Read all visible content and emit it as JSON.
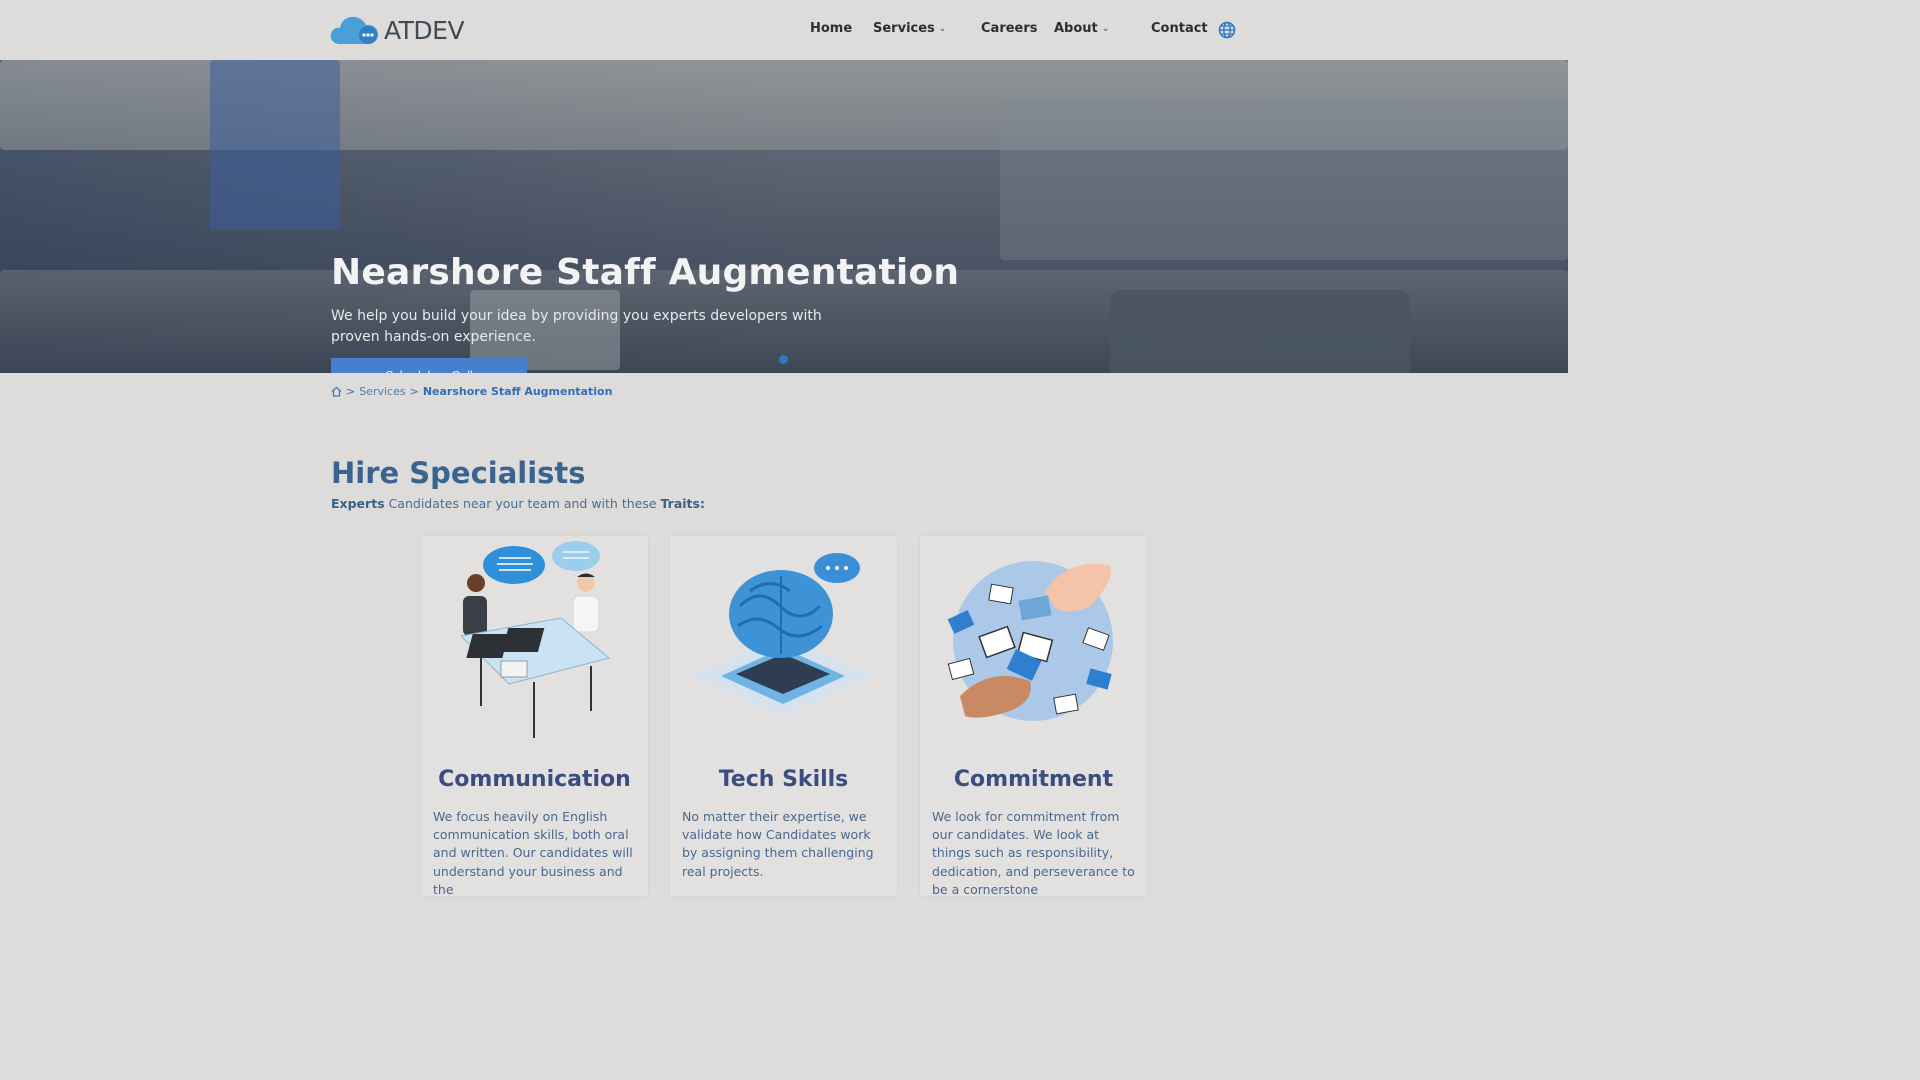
{
  "header": {
    "logo_text": "ATDEV",
    "nav": [
      {
        "label": "Home"
      },
      {
        "label": "Services",
        "dropdown": true
      },
      {
        "label": "Careers"
      },
      {
        "label": "About",
        "dropdown": true
      },
      {
        "label": "Contact"
      }
    ],
    "globe_icon": "globe-icon"
  },
  "hero": {
    "title": "Nearshore Staff Augmentation",
    "subtitle": "We help you build your idea by providing you experts developers with proven hands-on experience.",
    "cta_label": "Schedule a Call"
  },
  "breadcrumb": {
    "home_icon": "home-icon",
    "sep": ">",
    "items": [
      "Services",
      "Nearshore Staff Augmentation"
    ]
  },
  "section": {
    "title": "Hire Specialists",
    "subtitle_parts": [
      "Experts",
      " Candidates near your team and with these ",
      "Traits:"
    ]
  },
  "cards": [
    {
      "title": "Communication",
      "text": "We focus heavily on English communication skills, both oral and written. Our candidates will understand your business and the"
    },
    {
      "title": "Tech Skills",
      "text": "No matter their expertise, we validate how Candidates work by assigning them challenging real projects."
    },
    {
      "title": "Commitment",
      "text": "We look for commitment from our candidates. We look at things such as responsibility, dedication, and perseverance to be a cornerstone"
    }
  ],
  "colors": {
    "page_bg": "#dddcda",
    "accent": "#4680cc",
    "heading": "#3b6390",
    "card_title": "#3a4c80"
  }
}
